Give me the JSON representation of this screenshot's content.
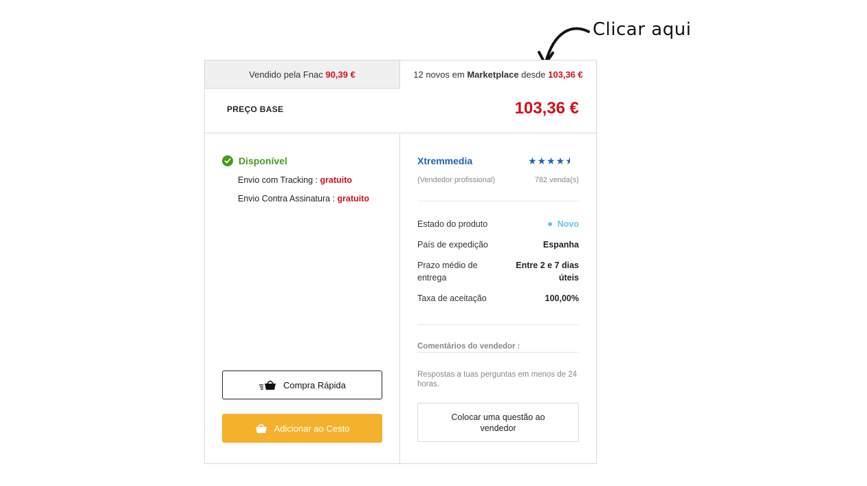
{
  "annotation": {
    "text": "Clicar aqui"
  },
  "tabs": {
    "fnac": {
      "label": "Vendido pela Fnac",
      "price": "90,39 €"
    },
    "marketplace": {
      "count_text": "12 novos em",
      "name": "Marketplace",
      "from_text": "desde",
      "price": "103,36 €"
    }
  },
  "base": {
    "label": "PREÇO BASE",
    "price": "103,36 €"
  },
  "availability": {
    "status": "Disponível",
    "shipping": [
      {
        "label": "Envio com Tracking :",
        "value": "gratuito"
      },
      {
        "label": "Envio Contra Assinatura :",
        "value": "gratuito"
      }
    ]
  },
  "actions": {
    "quick_buy": "Compra Rápida",
    "add_to_cart": "Adicionar ao Cesto"
  },
  "seller": {
    "name": "Xtremmedia",
    "rating": 4.5,
    "stars_text": "★★★★",
    "type": "(Vendedor profissional)",
    "sales": "782 venda(s)",
    "specs": [
      {
        "label": "Estado do produto",
        "value": "Novo"
      },
      {
        "label": "País de expedição",
        "value": "Espanha"
      },
      {
        "label": "Prazo médio de entrega",
        "value": "Entre 2 e 7 dias úteis"
      },
      {
        "label": "Taxa de aceitação",
        "value": "100,00%"
      }
    ],
    "comments_title": "Comentários do vendedor :",
    "reply_text": "Respostas a tuas perguntas em menos de 24 horas.",
    "question_button": "Colocar uma questão ao vendedor"
  },
  "colors": {
    "price_red": "#d0101c",
    "available_green": "#4a9a1e",
    "seller_blue": "#1d63b8",
    "cart_yellow": "#f4b12b",
    "new_cyan": "#6bc3e6"
  }
}
